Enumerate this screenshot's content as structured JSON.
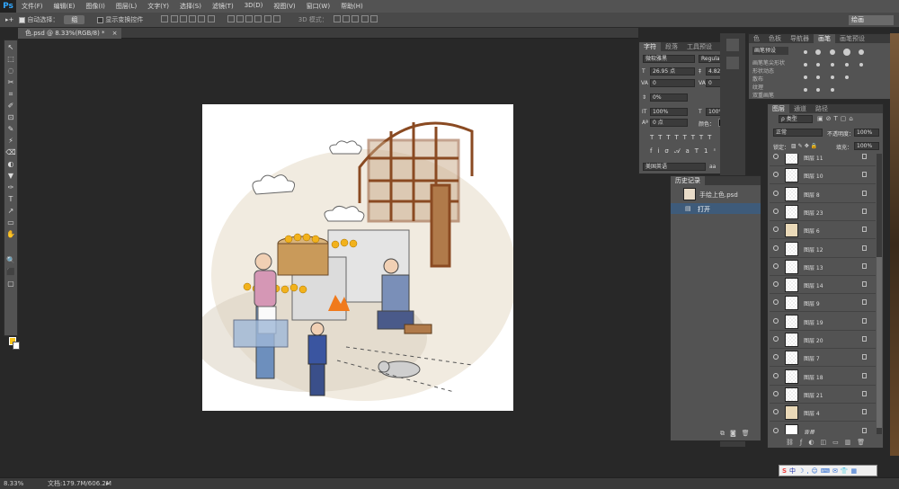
{
  "app": {
    "logo": "Ps"
  },
  "menu": [
    "文件(F)",
    "编辑(E)",
    "图像(I)",
    "图层(L)",
    "文字(Y)",
    "选择(S)",
    "滤镜(T)",
    "3D(D)",
    "视图(V)",
    "窗口(W)",
    "帮助(H)"
  ],
  "options": {
    "auto_select_label": "自动选择：",
    "auto_select_value": "组",
    "show_transform_label": "显示变换控件",
    "mode_3d_label": "3D 模式：",
    "workspace": "绘画"
  },
  "document": {
    "tab_title": "色.psd @ 8.33%(RGB/8) *",
    "close": "×"
  },
  "tools": [
    "↖",
    "⬚",
    "◌",
    "✂",
    "⌗",
    "✐",
    "⊡",
    "✎",
    "⚡",
    "⌫",
    "◐",
    "▼",
    "✑",
    "T",
    "↗",
    "▭",
    "✋",
    "🔍",
    "⬛",
    "▢"
  ],
  "character_panel": {
    "tabs": [
      "字符",
      "段落",
      "工具预设"
    ],
    "font_family": "微软雅黑",
    "font_style": "Regular",
    "font_size": "26.95 点",
    "leading": "4.82 点",
    "kerning": "0",
    "tracking": "0",
    "scale_percent": "0%",
    "vscale": "100%",
    "hscale": "100%",
    "baseline": "0 点",
    "color_label": "颜色：",
    "language": "美国英语",
    "antialias": "平滑",
    "aa_label": "aa"
  },
  "brush_panel": {
    "tabs": [
      "色",
      "色板",
      "导航器",
      "画笔",
      "画笔预设"
    ],
    "button": "画笔预设",
    "items": [
      "画笔笔尖形状",
      "形状动态",
      "散布",
      "纹理",
      "双重画笔",
      "颜色动态",
      "传递",
      "画笔笔势",
      "杂色",
      "湿边",
      "建立",
      "平滑",
      "保护纹理"
    ]
  },
  "history_panel": {
    "tab": "历史记录",
    "snapshot": "手绘上色.psd",
    "steps": [
      "打开"
    ]
  },
  "layers_panel": {
    "tabs": [
      "图层",
      "通道",
      "路径"
    ],
    "filter_kind": "ρ 类型",
    "blend_mode": "正常",
    "opacity_label": "不透明度：",
    "opacity": "100%",
    "lock_label": "锁定：",
    "fill_label": "填充：",
    "fill": "100%",
    "layers": [
      "图层 11",
      "图层 10",
      "图层 8",
      "图层 23",
      "图层 6",
      "图层 12",
      "图层 13",
      "图层 14",
      "图层 9",
      "图层 19",
      "图层 20",
      "图层 7",
      "图层 18",
      "图层 21",
      "图层 4",
      "背景"
    ]
  },
  "status": {
    "zoom": "8.33%",
    "doc_info": "文档:179.7M/606.2M"
  },
  "ime": {
    "label": "S",
    "mode": "中"
  },
  "colors": {
    "foreground": "#f7c51e",
    "background": "#ffffff",
    "ui": "#535353"
  }
}
